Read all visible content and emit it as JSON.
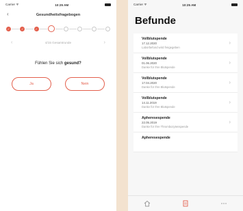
{
  "status_left": {
    "carrier": "Carrier ᯤ",
    "time": "10:25 AM"
  },
  "status_right": {
    "carrier": "Carrier ᯤ",
    "time": "10:25 AM"
  },
  "questionnaire": {
    "title": "Gesundheitsfragebogen",
    "back_icon": "chevron-left-icon",
    "forward_icon": "chevron-right-icon",
    "steps": [
      {
        "state": "done"
      },
      {
        "state": "done"
      },
      {
        "state": "done"
      },
      {
        "state": "current"
      },
      {
        "state": "todo"
      },
      {
        "state": "todo"
      },
      {
        "state": "todo"
      },
      {
        "state": "todo"
      }
    ],
    "page_indicator": "4/15 Gesamtrunde",
    "question_prefix": "Fühlen Sie sich ",
    "question_emphasis": "gesund?",
    "answer_yes": "Ja",
    "answer_no": "Nein",
    "accent_color": "#e35f4c"
  },
  "findings": {
    "title": "Befunde",
    "items": [
      {
        "type": "Vollblutspende",
        "date": "17.12.2020",
        "status": "Laborbefund wird freigegeben"
      },
      {
        "type": "Vollblutspende",
        "date": "01.06.2020",
        "status": "Danke für Ihre Blutspende"
      },
      {
        "type": "Vollblutspende",
        "date": "17.04.2020",
        "status": "Danke für Ihre Blutspende"
      },
      {
        "type": "Vollblutspende",
        "date": "14.11.2019",
        "status": "Danke für Ihre Blutspende"
      },
      {
        "type": "Apheresespende",
        "date": "22.05.2019",
        "status": "Danke für Ihre Thrombozytenspende"
      },
      {
        "type": "Apheresespende",
        "date": "",
        "status": ""
      }
    ],
    "tabs": [
      {
        "icon": "home-icon"
      },
      {
        "icon": "document-icon"
      },
      {
        "icon": "more-icon"
      }
    ]
  }
}
